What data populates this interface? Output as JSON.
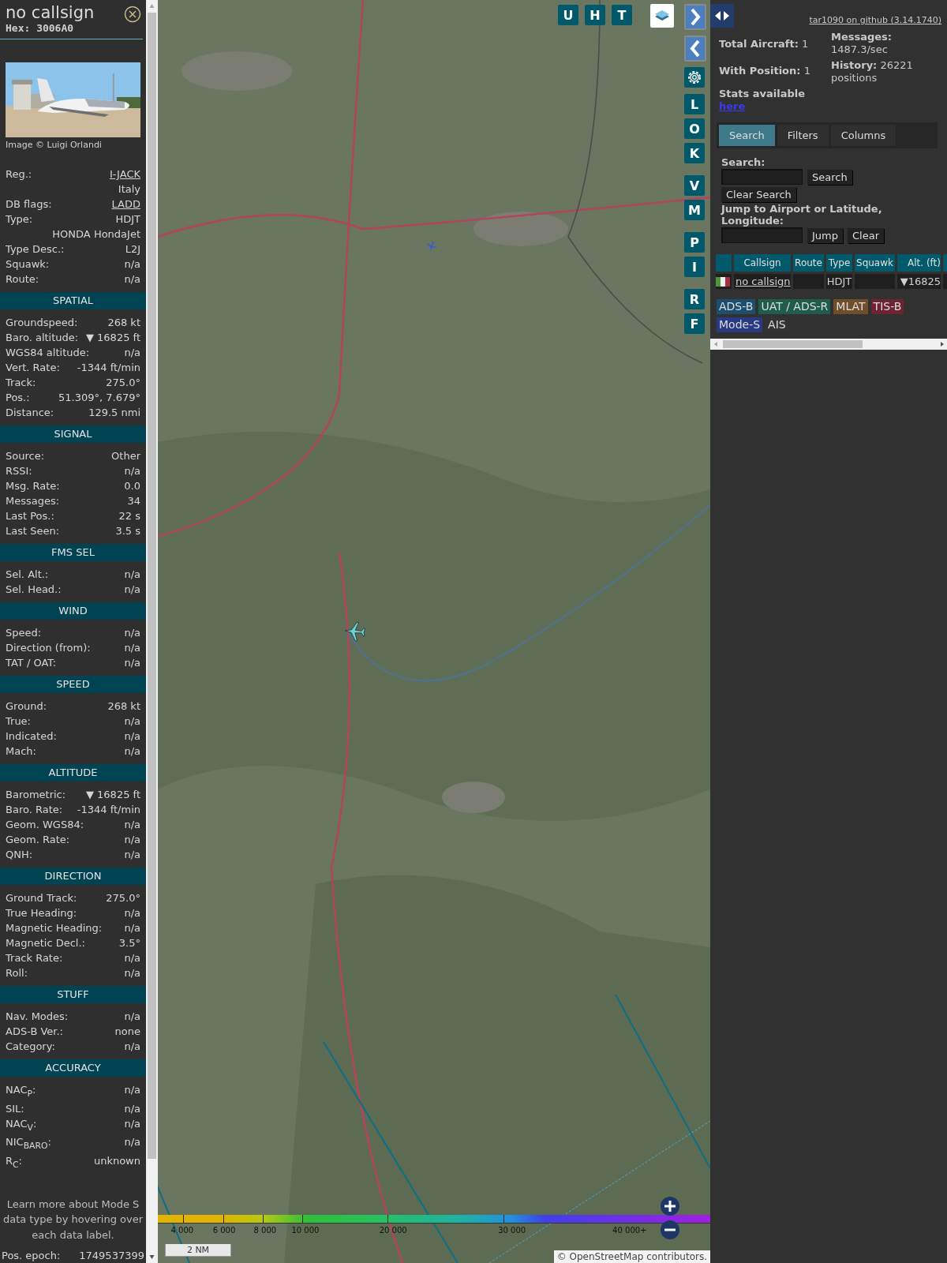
{
  "detail": {
    "callsign": "no callsign",
    "hex": "Hex: 3006A0",
    "photo_credit": "Image © Luigi Orlandi",
    "info_rows": [
      {
        "label": "Reg.:",
        "value": "I-JACK",
        "link": true
      },
      {
        "value": "Italy",
        "link": false
      },
      {
        "label": "DB flags:",
        "value": "LADD",
        "link": true
      },
      {
        "label": "Type:",
        "value": "HDJT",
        "link": false
      },
      {
        "value": "HONDA HondaJet",
        "link": false
      },
      {
        "label": "Type Desc.:",
        "value": "L2J",
        "link": false
      },
      {
        "label": "Squawk:",
        "value": "n/a",
        "link": false
      },
      {
        "label": "Route:",
        "value": "n/a",
        "link": false
      }
    ],
    "sections": [
      {
        "title": "SPATIAL",
        "rows": [
          {
            "label": "Groundspeed:",
            "value": "268 kt"
          },
          {
            "label": "Baro. altitude:",
            "value": "▼ 16825 ft"
          },
          {
            "label": "WGS84 altitude:",
            "value": "n/a"
          },
          {
            "label": "Vert. Rate:",
            "value": "-1344 ft/min"
          },
          {
            "label": "Track:",
            "value": "275.0°"
          },
          {
            "label": "Pos.:",
            "value": "51.309°, 7.679°"
          },
          {
            "label": "Distance:",
            "value": "129.5 nmi"
          }
        ]
      },
      {
        "title": "SIGNAL",
        "rows": [
          {
            "label": "Source:",
            "value": "Other"
          },
          {
            "label": "RSSI:",
            "value": "n/a"
          },
          {
            "label": "Msg. Rate:",
            "value": "0.0"
          },
          {
            "label": "Messages:",
            "value": "34"
          },
          {
            "label": "Last Pos.:",
            "value": "22 s"
          },
          {
            "label": "Last Seen:",
            "value": "3.5 s"
          }
        ]
      },
      {
        "title": "FMS SEL",
        "rows": [
          {
            "label": "Sel. Alt.:",
            "value": "n/a"
          },
          {
            "label": "Sel. Head.:",
            "value": "n/a"
          }
        ]
      },
      {
        "title": "WIND",
        "rows": [
          {
            "label": "Speed:",
            "value": "n/a"
          },
          {
            "label": "Direction (from):",
            "value": "n/a"
          },
          {
            "label": "TAT / OAT:",
            "value": "n/a"
          }
        ]
      },
      {
        "title": "SPEED",
        "rows": [
          {
            "label": "Ground:",
            "value": "268 kt"
          },
          {
            "label": "True:",
            "value": "n/a"
          },
          {
            "label": "Indicated:",
            "value": "n/a"
          },
          {
            "label": "Mach:",
            "value": "n/a"
          }
        ]
      },
      {
        "title": "ALTITUDE",
        "rows": [
          {
            "label": "Barometric:",
            "value": "▼ 16825 ft"
          },
          {
            "label": "Baro. Rate:",
            "value": "-1344 ft/min"
          },
          {
            "label": "Geom. WGS84:",
            "value": "n/a"
          },
          {
            "label": "Geom. Rate:",
            "value": "n/a"
          },
          {
            "label": "QNH:",
            "value": "n/a"
          }
        ]
      },
      {
        "title": "DIRECTION",
        "rows": [
          {
            "label": "Ground Track:",
            "value": "275.0°"
          },
          {
            "label": "True Heading:",
            "value": "n/a"
          },
          {
            "label": "Magnetic Heading:",
            "value": "n/a"
          },
          {
            "label": "Magnetic Decl.:",
            "value": "3.5°"
          },
          {
            "label": "Track Rate:",
            "value": "n/a"
          },
          {
            "label": "Roll:",
            "value": "n/a"
          }
        ]
      },
      {
        "title": "STUFF",
        "rows": [
          {
            "label": "Nav. Modes:",
            "value": "n/a"
          },
          {
            "label": "ADS-B Ver.:",
            "value": "none"
          },
          {
            "label": "Category:",
            "value": "n/a"
          }
        ]
      },
      {
        "title": "ACCURACY",
        "rows": [
          {
            "label": "NAC$_{P}$:",
            "value": "n/a"
          },
          {
            "label": "SIL:",
            "value": "n/a"
          },
          {
            "label": "NAC$_{V}$:",
            "value": "n/a"
          },
          {
            "label": "NIC$_{BARO}$:",
            "value": "n/a"
          },
          {
            "label": "R$_{C}$:",
            "value": "unknown"
          }
        ]
      }
    ],
    "note": "Learn more about Mode S data type by hovering over each data label.",
    "epoch": {
      "label": "Pos. epoch:",
      "value": "1749537399"
    }
  },
  "map": {
    "kind": "picture",
    "top_buttons": [
      "U",
      "H",
      "T"
    ],
    "side_button_groups": [
      [
        "L",
        "O",
        "K"
      ],
      [
        "V",
        "M"
      ],
      [
        "P",
        "I"
      ],
      [
        "R",
        "F"
      ]
    ],
    "altitude_labels": [
      "4 000",
      "6 000",
      "8 000",
      "10 000",
      "20 000",
      "30 000",
      "40 000+"
    ],
    "scale": "2 NM",
    "attribution": "© OpenStreetMap contributors."
  },
  "side": {
    "github_link": "tar1090 on github (3.14.1740)",
    "stats_left": [
      {
        "label": "Total Aircraft:",
        "value": "1"
      },
      {
        "label": "With Position:",
        "value": "1"
      }
    ],
    "stats_right": [
      {
        "label": "Messages:",
        "value": "1487.3/sec"
      },
      {
        "label": "History:",
        "value": "26221 positions"
      }
    ],
    "stats_note": "Stats available",
    "stats_link": "here",
    "tabs": [
      {
        "label": "Search",
        "selected": true
      },
      {
        "label": "Filters",
        "selected": false
      },
      {
        "label": "Columns",
        "selected": false
      }
    ],
    "search": {
      "label": "Search:",
      "buttons": [
        "Search",
        "Clear Search"
      ]
    },
    "jump": {
      "label": "Jump to Airport or Latitude, Longitude:",
      "buttons": [
        "Jump",
        "Clear"
      ]
    },
    "table": {
      "columns": [
        "Callsign",
        "Route",
        "Type",
        "Squawk",
        "Alt. (ft)"
      ],
      "rows": [
        {
          "callsign": "no callsign",
          "type": "HDJT",
          "altitude": "▼16825"
        }
      ]
    },
    "sources": [
      {
        "label": "ADS-B",
        "color": "#1d4e70"
      },
      {
        "label": "UAT / ADS-R",
        "color": "#1f5c4c"
      },
      {
        "label": "MLAT",
        "color": "#6e4f2a"
      },
      {
        "label": "TIS-B",
        "color": "#6e2330"
      },
      {
        "label": "Mode-S",
        "color": "#283a82"
      },
      {
        "label": "AIS",
        "color": "#333333"
      }
    ]
  }
}
